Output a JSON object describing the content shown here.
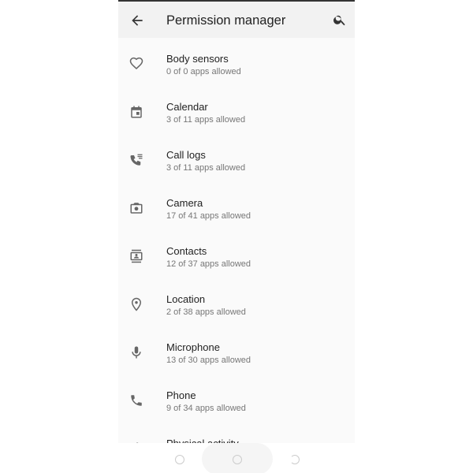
{
  "header": {
    "title": "Permission manager",
    "back_icon": "arrow-left-icon",
    "search_icon": "search-icon"
  },
  "permissions": [
    {
      "label": "Body sensors",
      "status": "0 of 0 apps allowed",
      "icon": "heart-icon"
    },
    {
      "label": "Calendar",
      "status": "3 of 11 apps allowed",
      "icon": "calendar-icon"
    },
    {
      "label": "Call logs",
      "status": "3 of 11 apps allowed",
      "icon": "call-log-icon"
    },
    {
      "label": "Camera",
      "status": "17 of 41 apps allowed",
      "icon": "camera-icon"
    },
    {
      "label": "Contacts",
      "status": "12 of 37 apps allowed",
      "icon": "contacts-icon"
    },
    {
      "label": "Location",
      "status": "2 of 38 apps allowed",
      "icon": "location-icon"
    },
    {
      "label": "Microphone",
      "status": "13 of 30 apps allowed",
      "icon": "microphone-icon"
    },
    {
      "label": "Phone",
      "status": "9 of 34 apps allowed",
      "icon": "phone-icon"
    },
    {
      "label": "Physical activity",
      "status": "",
      "icon": "activity-icon"
    }
  ],
  "navbar": {
    "buttons": [
      "back",
      "home",
      "recents"
    ]
  }
}
